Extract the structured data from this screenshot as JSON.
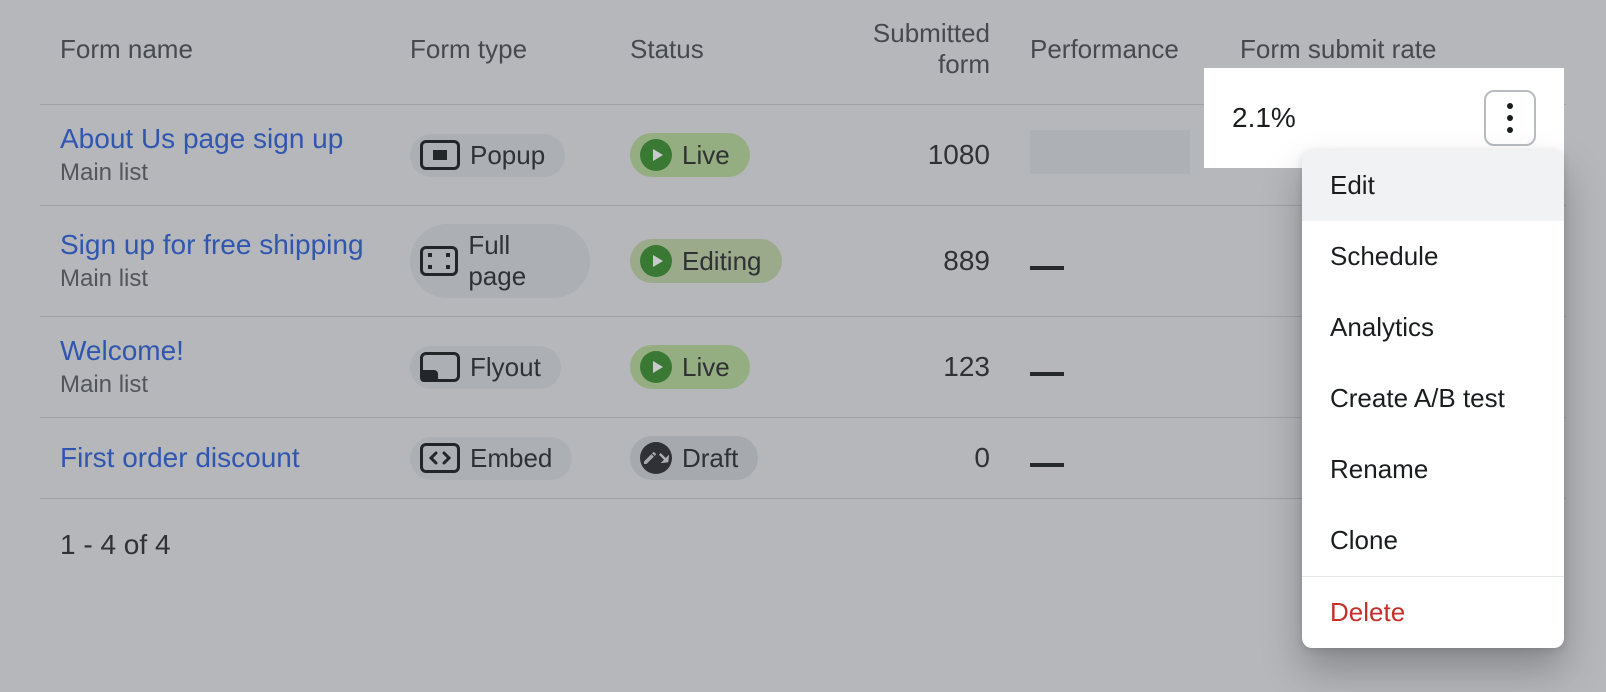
{
  "columns": {
    "name": "Form name",
    "type": "Form type",
    "status": "Status",
    "submitted": "Submitted form",
    "performance": "Performance",
    "rate": "Form submit rate"
  },
  "rows": [
    {
      "name": "About Us page sign up",
      "sublabel": "Main list",
      "type_label": "Popup",
      "status_label": "Live",
      "submitted": "1080",
      "performance": "redacted",
      "rate": "2.1%"
    },
    {
      "name": "Sign up for free shipping",
      "sublabel": "Main list",
      "type_label": "Full page",
      "status_label": "Editing",
      "submitted": "889",
      "performance": "dash",
      "rate": ""
    },
    {
      "name": "Welcome!",
      "sublabel": "Main list",
      "type_label": "Flyout",
      "status_label": "Live",
      "submitted": "123",
      "performance": "dash",
      "rate": ""
    },
    {
      "name": "First order discount",
      "sublabel": "",
      "type_label": "Embed",
      "status_label": "Draft",
      "submitted": "0",
      "performance": "dash",
      "rate": ""
    }
  ],
  "footer_count": "1 - 4 of 4",
  "menu": {
    "edit": "Edit",
    "schedule": "Schedule",
    "analytics": "Analytics",
    "ab_test": "Create A/B test",
    "rename": "Rename",
    "clone": "Clone",
    "delete": "Delete"
  },
  "popout": {
    "rate_value": "2.1%"
  }
}
